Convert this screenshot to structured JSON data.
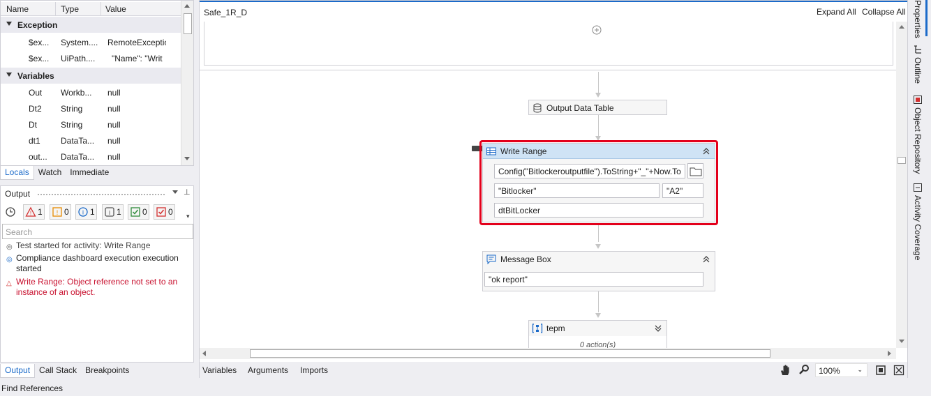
{
  "locals": {
    "headers": {
      "name": "Name",
      "type": "Type",
      "value": "Value"
    },
    "exception_section": "Exception",
    "exception_rows": [
      {
        "name": "$ex...",
        "type": "System....",
        "value": "RemoteExceptio"
      },
      {
        "name": "$ex...",
        "type": "UiPath....",
        "value": "\"Name\": \"Writ"
      }
    ],
    "variables_section": "Variables",
    "variable_rows": [
      {
        "name": "Out",
        "type": "Workb...",
        "value": "null"
      },
      {
        "name": "Dt2",
        "type": "String",
        "value": "null"
      },
      {
        "name": "Dt",
        "type": "String",
        "value": "null"
      },
      {
        "name": "dt1",
        "type": "DataTa...",
        "value": "null"
      },
      {
        "name": "out...",
        "type": "DataTa...",
        "value": "null"
      }
    ],
    "tabs": [
      "Locals",
      "Watch",
      "Immediate"
    ]
  },
  "output": {
    "title": "Output",
    "filters": [
      {
        "icon": "error-icon",
        "count": "1",
        "color": "#d32f2f"
      },
      {
        "icon": "warning-icon",
        "count": "0",
        "color": "#e88a00"
      },
      {
        "icon": "info-icon",
        "count": "1",
        "color": "#1b6ac9"
      },
      {
        "icon": "trace-icon",
        "count": "1",
        "color": "#555555"
      },
      {
        "icon": "success-icon",
        "count": "0",
        "color": "#2e8b3a"
      },
      {
        "icon": "fail-icon",
        "count": "0",
        "color": "#d32f2f"
      }
    ],
    "search_placeholder": "Search",
    "log": [
      {
        "kind": "trace",
        "text": "Test started for activity: Write Range"
      },
      {
        "kind": "info",
        "text": "Compliance dashboard execution execution started"
      },
      {
        "kind": "error",
        "text": "Write Range: Object reference not set to an instance of an object."
      }
    ],
    "tabs": [
      "Output",
      "Call Stack",
      "Breakpoints"
    ]
  },
  "designer": {
    "title": "Safe_1R_D",
    "expand_all": "Expand All",
    "collapse_all": "Collapse All",
    "output_data_table": "Output Data Table",
    "write_range": {
      "title": "Write Range",
      "path": "Config(\"Bitlockeroutputfile\").ToString+\"_\"+Now.To",
      "sheet": "\"Bitlocker\"",
      "cell": "\"A2\"",
      "datatable": "dtBitLocker"
    },
    "message_box": {
      "title": "Message Box",
      "text": "\"ok report\""
    },
    "tepm": {
      "title": "tepm",
      "placeholder": "0 action(s)"
    },
    "bottom_tabs": [
      "Variables",
      "Arguments",
      "Imports"
    ],
    "zoom": "100%",
    "highlight_color": "#e3001b"
  },
  "right_tabs": [
    "Properties",
    "Outline",
    "Object Repository",
    "Activity Coverage"
  ],
  "status": "Find References"
}
